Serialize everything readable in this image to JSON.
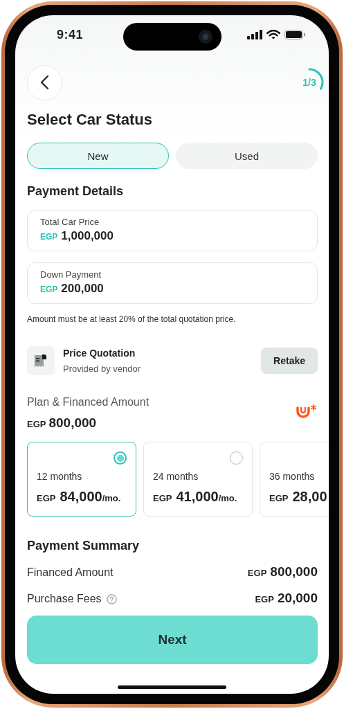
{
  "status_bar": {
    "time": "9:41"
  },
  "progress": {
    "label": "1/3",
    "level": 0.33
  },
  "title": "Select Car Status",
  "car_status_tabs": [
    {
      "label": "New",
      "selected": true
    },
    {
      "label": "Used",
      "selected": false
    }
  ],
  "payment_details": {
    "heading": "Payment Details",
    "fields": [
      {
        "label": "Total Car Price",
        "currency": "EGP",
        "value": "1,000,000"
      },
      {
        "label": "Down Payment",
        "currency": "EGP",
        "value": "200,000"
      }
    ],
    "note": "Amount must be at least 20% of the total quotation price."
  },
  "quotation": {
    "title": "Price Quotation",
    "subtitle": "Provided by vendor",
    "button": "Retake"
  },
  "plan": {
    "heading": "Plan & Financed Amount",
    "currency": "EGP",
    "amount": "800,000",
    "options": [
      {
        "duration": "12 months",
        "currency": "EGP",
        "amount": "84,000",
        "unit": "/mo.",
        "selected": true
      },
      {
        "duration": "24 months",
        "currency": "EGP",
        "amount": "41,000",
        "unit": "/mo.",
        "selected": false
      },
      {
        "duration": "36 months",
        "currency": "EGP",
        "amount": "28,00",
        "selected": false,
        "clipped": true
      }
    ]
  },
  "summary": {
    "heading": "Payment Summary",
    "rows": [
      {
        "label": "Financed Amount",
        "currency": "EGP",
        "amount": "800,000",
        "info": false
      },
      {
        "label": "Purchase Fees",
        "currency": "EGP",
        "amount": "20,000",
        "info": true
      }
    ]
  },
  "next_button": "Next"
}
